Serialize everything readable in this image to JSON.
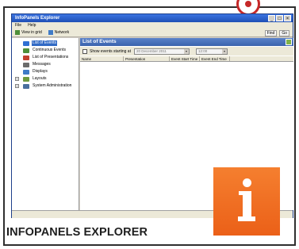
{
  "window": {
    "title": "InfoPanels Explorer",
    "controls": [
      "_",
      "□",
      "×"
    ]
  },
  "menu": [
    "File",
    "Help"
  ],
  "toolbar": {
    "left": [
      {
        "label": "View in grid",
        "icon": "grid-view-icon"
      },
      {
        "label": "Network",
        "icon": "network-icon"
      }
    ],
    "right": [
      "Find",
      "Go"
    ]
  },
  "sidebar": {
    "items": [
      {
        "label": "List of Events",
        "icon": "events-icon",
        "color": "#2f6fd3",
        "selected": true
      },
      {
        "label": "Continuous Events",
        "icon": "continuous-events-icon",
        "color": "#4e8f3a",
        "selected": false
      },
      {
        "label": "List of Presentations",
        "icon": "presentations-icon",
        "color": "#c2402e",
        "selected": false
      },
      {
        "label": "Messages",
        "icon": "messages-icon",
        "color": "#6b6b6b",
        "selected": false
      },
      {
        "label": "Displays",
        "icon": "displays-icon",
        "color": "#3f7bc7",
        "selected": false
      },
      {
        "label": "Layouts",
        "icon": "layouts-icon",
        "color": "#6d9a3f",
        "selected": false
      },
      {
        "label": "System Administration",
        "icon": "system-admin-icon",
        "color": "#4a6f9e",
        "selected": false
      }
    ]
  },
  "main": {
    "title": "List of Events",
    "filter": {
      "checkbox_label": "Show events starting at",
      "date_value": "20 December 2011",
      "time_value": "12:00"
    },
    "columns": [
      "Name",
      "Presentation",
      "Event Start Time",
      "Event End Time"
    ]
  },
  "caption": "INFOPANELS EXPLORER",
  "badge": {
    "icon": "info-icon",
    "color": "#eb6018"
  }
}
